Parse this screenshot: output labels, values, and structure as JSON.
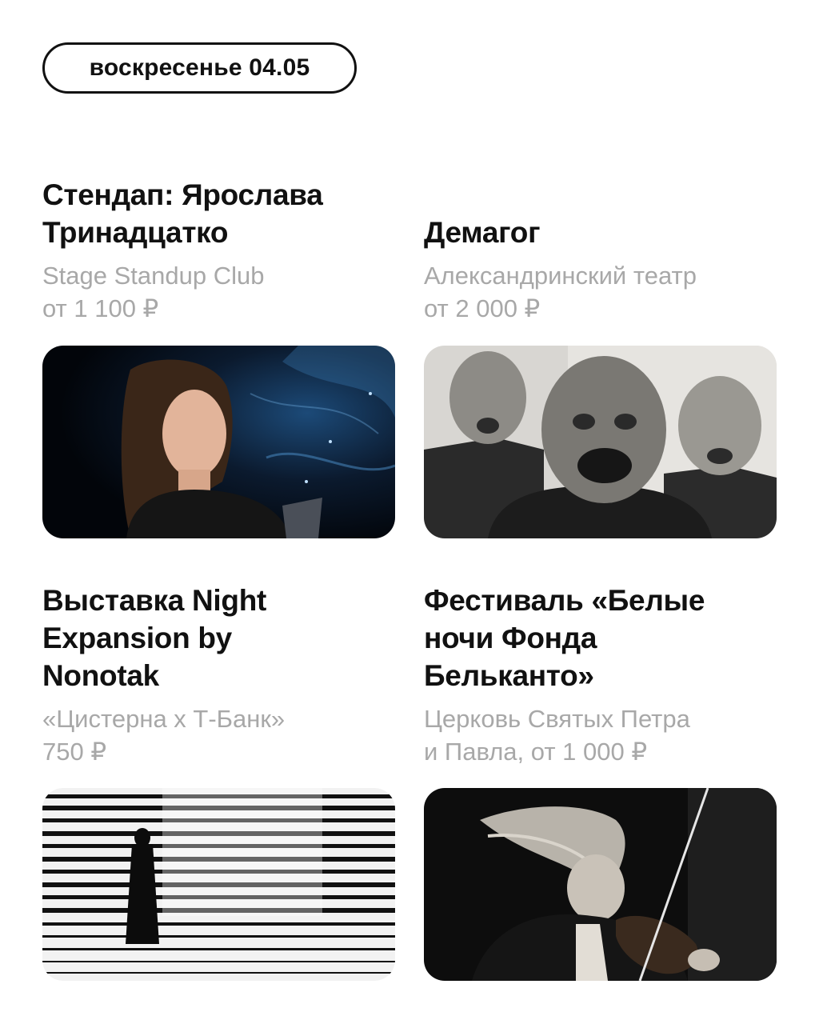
{
  "date_pill": "воскресенье 04.05",
  "events": [
    {
      "title_lines": [
        "Стендап: Ярослава",
        "Тринадцатко"
      ],
      "meta_lines": [
        "Stage Standup Club",
        "от 1 100 ₽"
      ]
    },
    {
      "title_lines": [
        "Демагог"
      ],
      "meta_lines": [
        "Александринский театр",
        "от 2 000 ₽"
      ]
    },
    {
      "title_lines": [
        "Выставка Night",
        "Expansion by",
        "Nonotak"
      ],
      "meta_lines": [
        "«Цистерна х Т-Банк»",
        "750 ₽"
      ]
    },
    {
      "title_lines": [
        "Фестиваль «Белые",
        "ночи Фонда",
        "Бельканто»"
      ],
      "meta_lines": [
        "Церковь Святых Петра",
        "и Павла, от 1 000 ₽"
      ]
    }
  ]
}
